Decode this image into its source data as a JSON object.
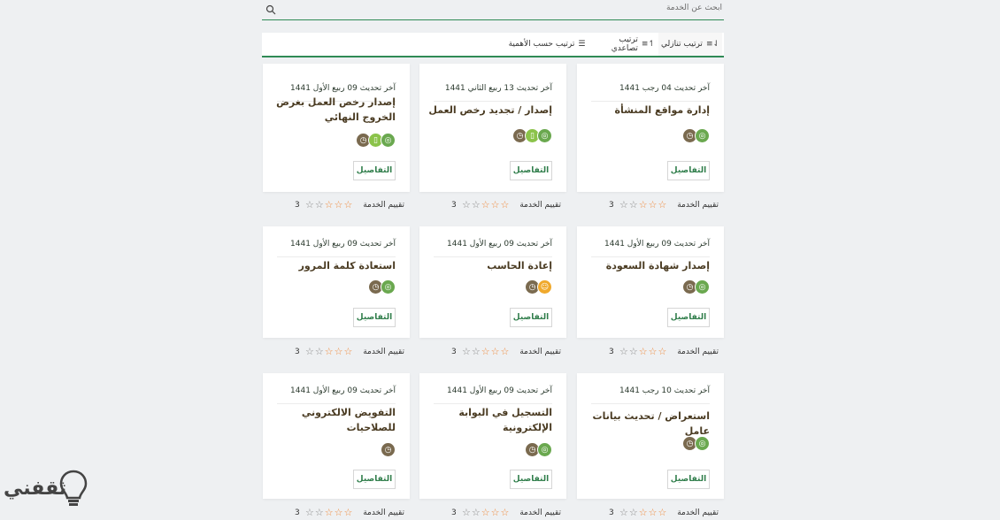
{
  "search": {
    "placeholder": "ابحث عن الخدمة"
  },
  "sort": {
    "descending": "ترتيب تنازلي",
    "ascending": "ترتيب تصاعدي",
    "importance": "ترتيب حسب الأهمية"
  },
  "rating_label": "تقييم الخدمة",
  "details_label": "التفاصيل",
  "logo_text": "ثقفني",
  "cards": [
    {
      "updated": "آخر تحديث 04 رجب 1441",
      "title": "إدارة مواقع المنشأة",
      "rating": 3,
      "icons": [
        "web-icon",
        "clock-icon"
      ]
    },
    {
      "updated": "آخر تحديث 13 ربيع الثاني 1441",
      "title": "إصدار / تجديد رخص العمل",
      "rating": 3,
      "icons": [
        "web-icon",
        "mobile-icon",
        "clock-icon"
      ]
    },
    {
      "updated": "آخر تحديث 09 ربيع الأول 1441",
      "title": "إصدار رخص العمل بغرض الخروج النهائي",
      "rating": 3,
      "icons": [
        "web-icon",
        "mobile-icon",
        "clock-icon"
      ]
    },
    {
      "updated": "آخر تحديث 09 ربيع الأول 1441",
      "title": "إصدار شهادة السعودة",
      "rating": 3,
      "icons": [
        "web-icon",
        "clock-icon"
      ]
    },
    {
      "updated": "آخر تحديث 09 ربيع الأول 1441",
      "title": "إعادة الحاسب",
      "rating": 3,
      "icons": [
        "user-icon",
        "clock-icon"
      ]
    },
    {
      "updated": "آخر تحديث 09 ربيع الأول 1441",
      "title": "استعادة كلمة المرور",
      "rating": 3,
      "icons": [
        "web-icon",
        "clock-icon"
      ]
    },
    {
      "updated": "آخر تحديث 10 رجب 1441",
      "title": "استعراض / تحديث بيانات عامل",
      "rating": 3,
      "icons": [
        "web-icon",
        "clock-icon"
      ]
    },
    {
      "updated": "آخر تحديث 09 ربيع الأول 1441",
      "title": "التسجيل في البوابة الإلكترونية",
      "rating": 3,
      "icons": [
        "web-icon",
        "clock-icon"
      ]
    },
    {
      "updated": "آخر تحديث 09 ربيع الأول 1441",
      "title": "التفويض الالكتروني للصلاحيات",
      "rating": 3,
      "icons": [
        "clock-icon"
      ]
    }
  ],
  "colors": {
    "accent": "#2f8a55",
    "star": "#f08a3c",
    "title": "#4a3b22"
  }
}
